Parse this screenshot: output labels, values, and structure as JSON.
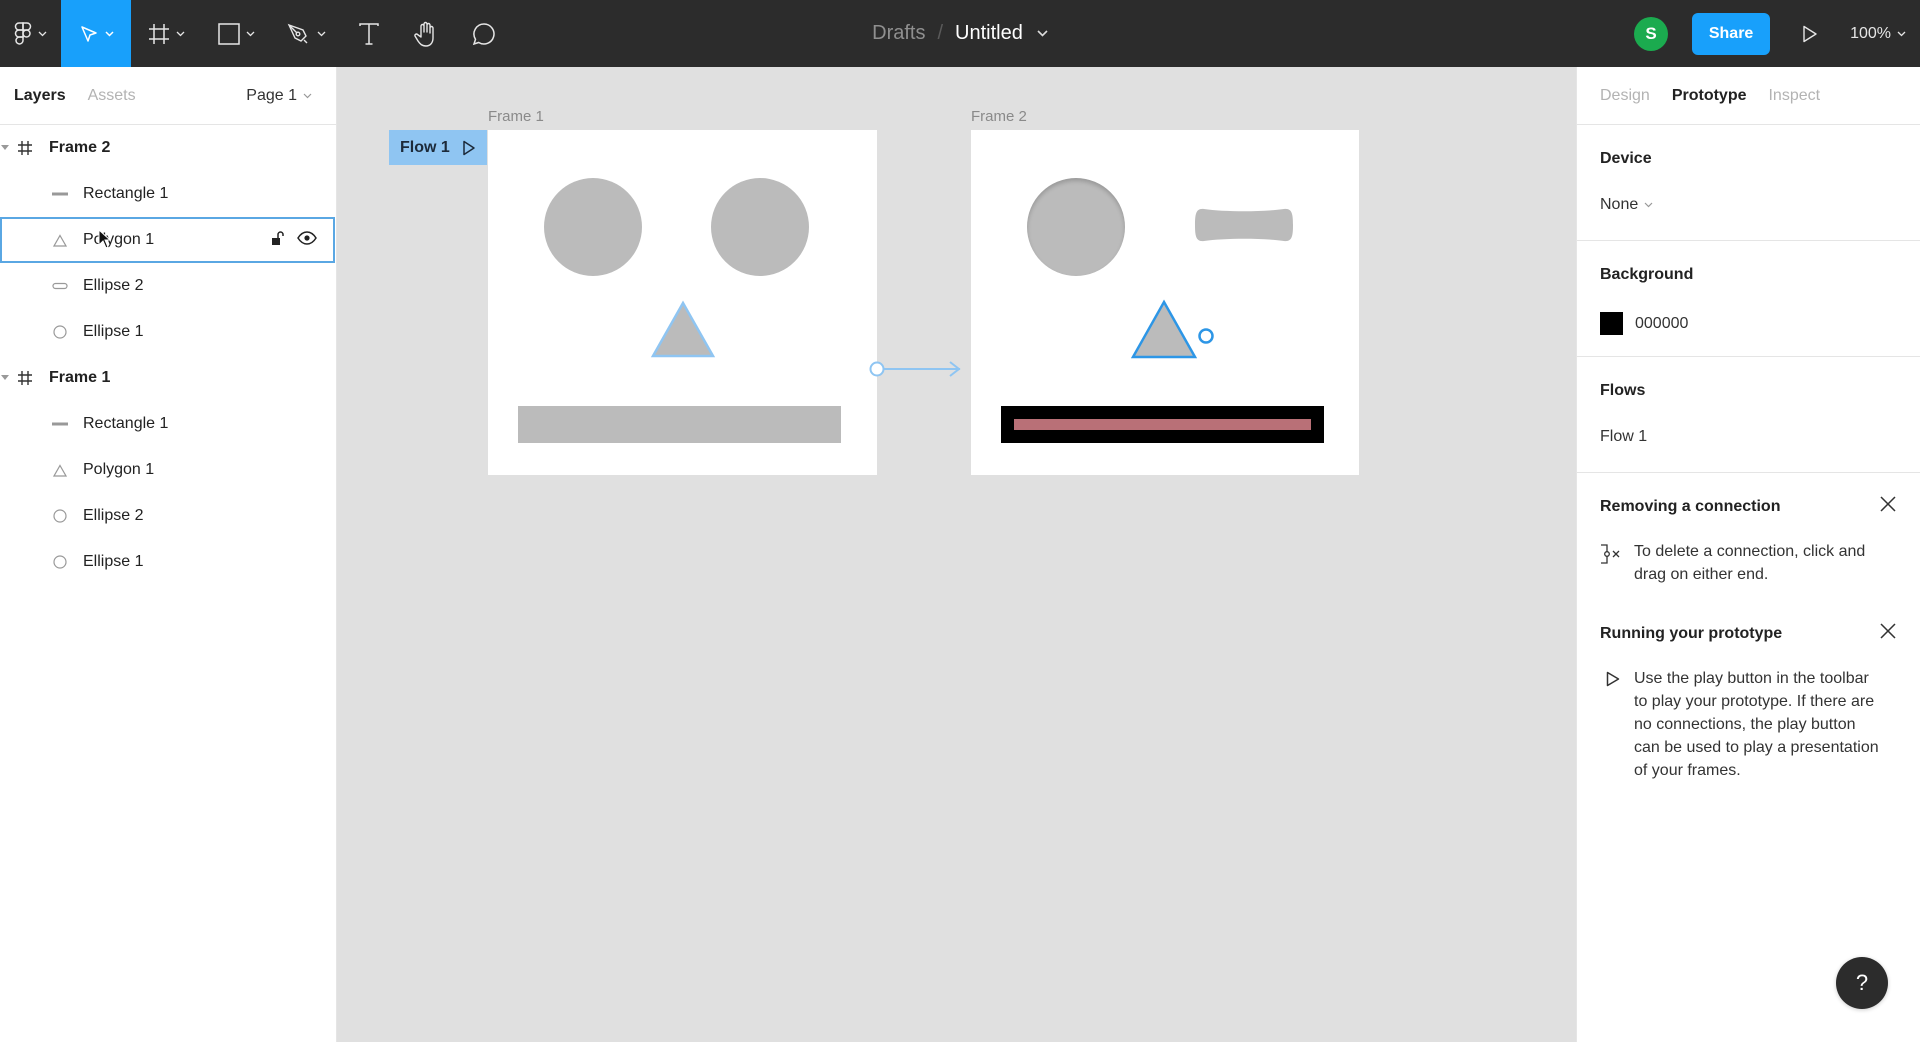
{
  "toolbar": {
    "tools": [
      {
        "name": "main-menu",
        "icon": "figma-logo-icon"
      },
      {
        "name": "move-tool",
        "icon": "cursor-arrow-icon",
        "active": true
      },
      {
        "name": "frame-tool",
        "icon": "frame-hash-icon"
      },
      {
        "name": "shape-tool",
        "icon": "rectangle-icon"
      },
      {
        "name": "pen-tool",
        "icon": "pen-icon"
      },
      {
        "name": "text-tool",
        "icon": "text-t-icon"
      },
      {
        "name": "hand-tool",
        "icon": "hand-icon"
      },
      {
        "name": "comment-tool",
        "icon": "comment-bubble-icon"
      }
    ],
    "breadcrumb_parent": "Drafts",
    "breadcrumb_sep": "/",
    "file_title": "Untitled",
    "avatar_initial": "S",
    "share_label": "Share",
    "zoom_level": "100%"
  },
  "left_panel": {
    "tabs": [
      {
        "label": "Layers",
        "active": true
      },
      {
        "label": "Assets",
        "active": false
      }
    ],
    "page_selector": "Page 1",
    "layers": [
      {
        "label": "Frame 2",
        "type": "frame",
        "icon": "frame-hash-icon",
        "expanded": true
      },
      {
        "label": "Rectangle 1",
        "type": "child",
        "icon": "line-rectangle-icon"
      },
      {
        "label": "Polygon 1",
        "type": "child",
        "icon": "triangle-icon",
        "selected": true
      },
      {
        "label": "Ellipse 2",
        "type": "child",
        "icon": "flat-ellipse-icon"
      },
      {
        "label": "Ellipse 1",
        "type": "child",
        "icon": "circle-icon"
      },
      {
        "label": "Frame 1",
        "type": "frame",
        "icon": "frame-hash-icon",
        "expanded": true
      },
      {
        "label": "Rectangle 1",
        "type": "child",
        "icon": "line-rectangle-icon"
      },
      {
        "label": "Polygon 1",
        "type": "child",
        "icon": "triangle-icon"
      },
      {
        "label": "Ellipse 2",
        "type": "child",
        "icon": "circle-icon"
      },
      {
        "label": "Ellipse 1",
        "type": "child",
        "icon": "circle-icon"
      }
    ]
  },
  "canvas": {
    "frames": [
      {
        "label": "Frame 1"
      },
      {
        "label": "Frame 2"
      }
    ],
    "flow_badge": "Flow 1",
    "colors": {
      "shape_fill": "#bbbbbb",
      "connection": "#8fc5f2",
      "selection": "#2d96e6",
      "bar_dark": "#000000",
      "bar_inner": "#b97077"
    },
    "help_label": "?"
  },
  "right_panel": {
    "tabs": [
      {
        "label": "Design",
        "active": false
      },
      {
        "label": "Prototype",
        "active": true
      },
      {
        "label": "Inspect",
        "active": false
      }
    ],
    "device": {
      "heading": "Device",
      "value": "None"
    },
    "background": {
      "heading": "Background",
      "value": "000000",
      "color": "#000000"
    },
    "flows": {
      "heading": "Flows",
      "items": [
        "Flow 1"
      ]
    },
    "tips": [
      {
        "title": "Removing a connection",
        "body": "To delete a connection, click and drag on either end."
      },
      {
        "title": "Running your prototype",
        "body": "Use the play button in the toolbar to play your prototype. If there are no connections, the play button can be used to play a presentation of your frames."
      }
    ]
  }
}
